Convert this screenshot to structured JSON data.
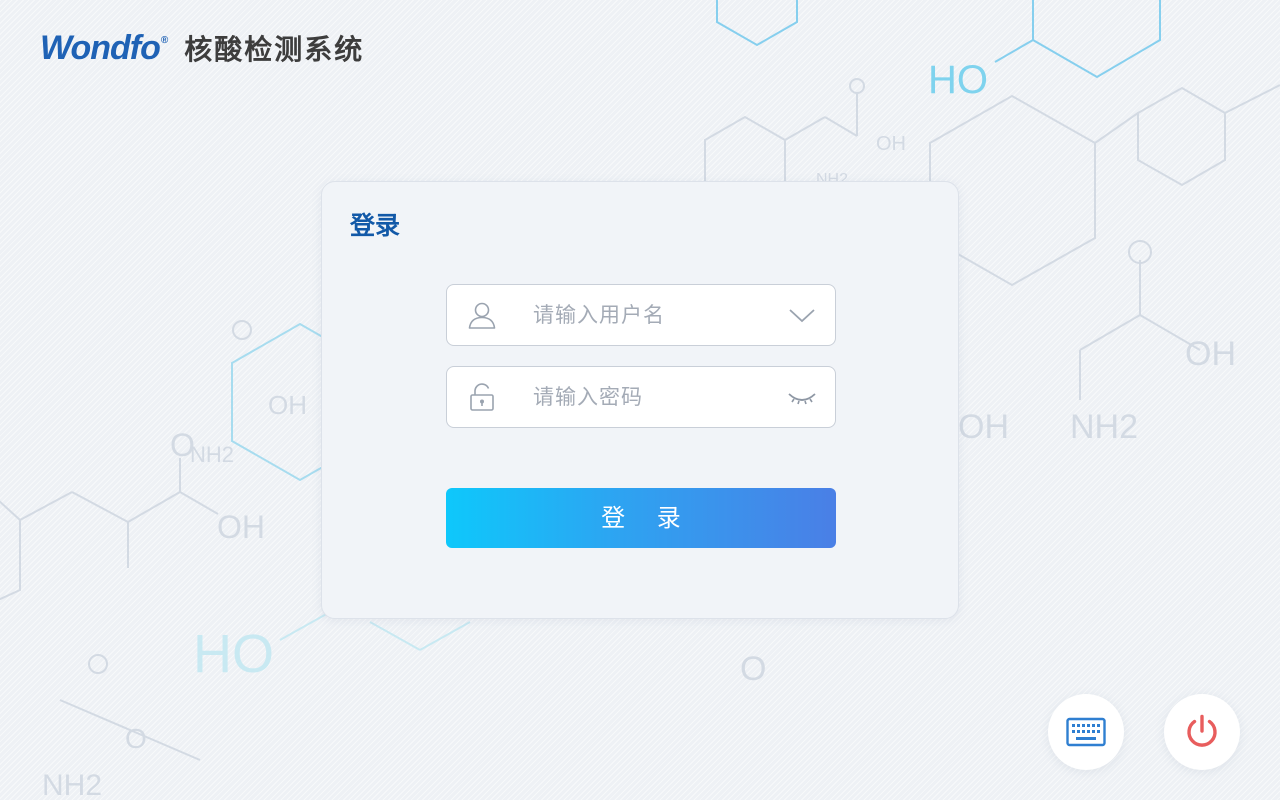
{
  "header": {
    "brand": "Wondfo",
    "registered": "®",
    "title": "核酸检测系统"
  },
  "login_card": {
    "title": "登录",
    "username": {
      "placeholder": "请输入用户名",
      "icon": "user-icon",
      "action_icon": "chevron-down-icon"
    },
    "password": {
      "placeholder": "请输入密码",
      "icon": "lock-icon",
      "action_icon": "eye-closed-icon"
    },
    "submit_label": "登 录"
  },
  "footer_buttons": {
    "keyboard_icon": "keyboard-icon",
    "power_icon": "power-icon"
  },
  "background": {
    "labels": [
      "HO",
      "OH",
      "NH2",
      "OH",
      "OH",
      "NH2",
      "OH",
      "NH2",
      "HO",
      "OH",
      "NH2",
      "O",
      "O",
      "O"
    ]
  },
  "colors": {
    "brand_blue": "#1f62b5",
    "title_blue": "#1259a8",
    "button_gradient_start": "#0ec8fb",
    "button_gradient_end": "#4a7fe6",
    "power_red": "#e85d5d",
    "keyboard_blue": "#2f7fd1"
  }
}
